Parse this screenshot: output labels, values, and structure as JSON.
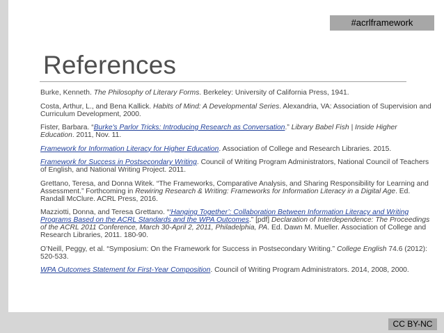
{
  "header": {
    "hashtag": "#acrlframework"
  },
  "title": "References",
  "references": [
    {
      "parts": [
        {
          "t": "text",
          "v": "Burke, Kenneth. "
        },
        {
          "t": "em",
          "v": "The Philosophy of Literary Forms"
        },
        {
          "t": "text",
          "v": ". Berkeley: University of California Press, 1941."
        }
      ]
    },
    {
      "parts": [
        {
          "t": "text",
          "v": "Costa, Arthur, L., and Bena Kallick. "
        },
        {
          "t": "em",
          "v": "Habits of Mind: A Developmental Series"
        },
        {
          "t": "text",
          "v": ". Alexandria, VA: Association of Supervision and Curriculum Development, 2000."
        }
      ]
    },
    {
      "parts": [
        {
          "t": "text",
          "v": "Fister, Barbara. “"
        },
        {
          "t": "link",
          "v": "Burke's Parlor Tricks: Introducing Research as Conversation"
        },
        {
          "t": "text",
          "v": ".” "
        },
        {
          "t": "em",
          "v": "Library Babel Fish | Inside Higher Education"
        },
        {
          "t": "text",
          "v": ". 2011, Nov. 11."
        }
      ]
    },
    {
      "parts": [
        {
          "t": "link",
          "v": "Framework for Information Literacy for Higher Education"
        },
        {
          "t": "text",
          "v": ". Association of College and Research Libraries. 2015."
        }
      ]
    },
    {
      "parts": [
        {
          "t": "link",
          "v": "Framework for Success in Postsecondary Writing"
        },
        {
          "t": "text",
          "v": ". Council of Writing Program Administrators, National Council of Teachers of English, and National Writing Project. 2011."
        }
      ]
    },
    {
      "parts": [
        {
          "t": "text",
          "v": "Grettano, Teresa, and Donna Witek. “The Frameworks, Comparative Analysis, and Sharing Responsibility for Learning and Assessment.” Forthcoming in "
        },
        {
          "t": "em",
          "v": "Rewiring Research & Writing: Frameworks for Information Literacy in a Digital Age"
        },
        {
          "t": "text",
          "v": ". Ed. Randall McClure. ACRL Press, 2016."
        }
      ]
    },
    {
      "parts": [
        {
          "t": "text",
          "v": "Mazziotti, Donna, and Teresa Grettano. “"
        },
        {
          "t": "link",
          "v": "‘Hanging Together’: Collaboration Between Information Literacy and Writing Programs Based on the ACRL Standards and the WPA Outcomes"
        },
        {
          "t": "text",
          "v": ".” [pdf] "
        },
        {
          "t": "em",
          "v": "Declaration of Interdependence: The Proceedings of the ACRL 2011 Conference, March 30-April 2, 2011, Philadelphia, PA"
        },
        {
          "t": "text",
          "v": ". Ed. Dawn M. Mueller. Association of College and Research Libraries, 2011. 180-90."
        }
      ]
    },
    {
      "parts": [
        {
          "t": "text",
          "v": "O’Neill, Peggy, et al. “Symposium: On the Framework for Success in Postsecondary Writing.” "
        },
        {
          "t": "em",
          "v": "College English"
        },
        {
          "t": "text",
          "v": " 74.6 (2012): 520-533."
        }
      ]
    },
    {
      "parts": [
        {
          "t": "link",
          "v": "WPA Outcomes Statement for First-Year Composition"
        },
        {
          "t": "text",
          "v": ". Council of Writing Program Administrators. 2014, 2008, 2000."
        }
      ]
    }
  ],
  "footer": {
    "license": "CC BY-NC"
  },
  "colors": {
    "link": "#1f3f9a",
    "badge": "#a7a7a7",
    "bar": "#d6d6d6"
  }
}
